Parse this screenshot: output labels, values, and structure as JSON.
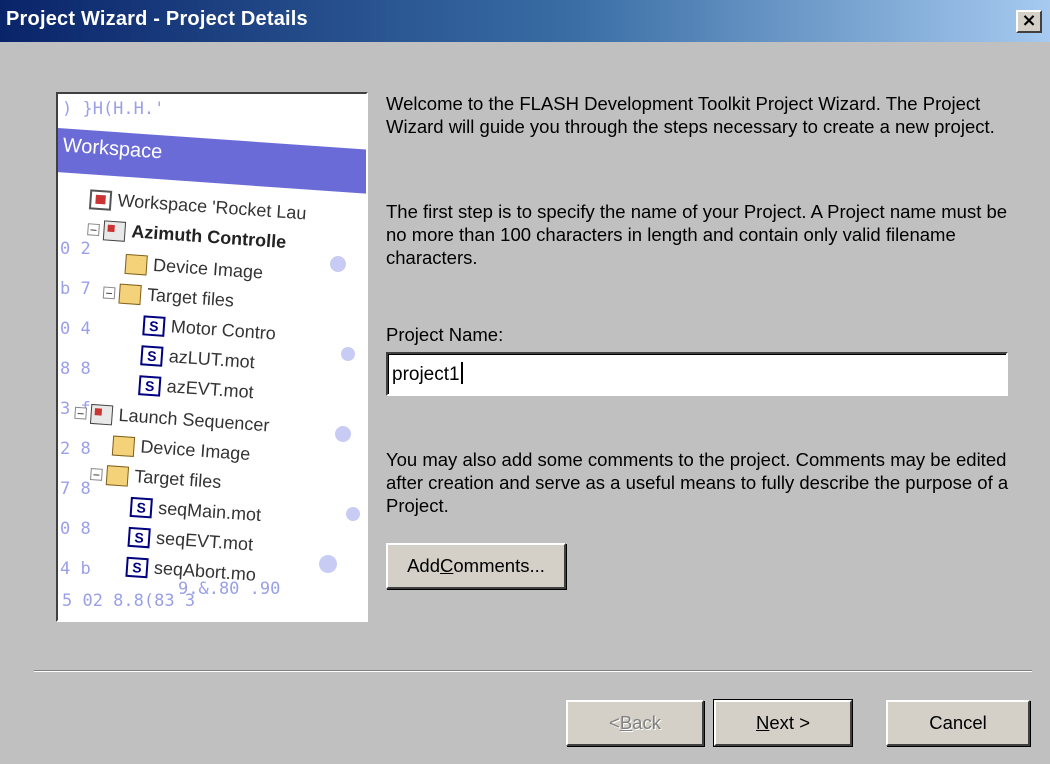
{
  "window": {
    "title": "Project Wizard - Project Details",
    "close_glyph": "×"
  },
  "illustration": {
    "workspace_header": "Workspace",
    "tree": [
      {
        "label": "Workspace 'Rocket Lau",
        "icon": "workspace-icon"
      },
      {
        "label": "Azimuth Controlle",
        "icon": "project-icon",
        "bold": true
      },
      {
        "label": "Device Image",
        "icon": "folder-icon"
      },
      {
        "label": "Target files",
        "icon": "folder-icon"
      },
      {
        "label": "Motor Contro",
        "icon": "s-file-icon"
      },
      {
        "label": "azLUT.mot",
        "icon": "s-file-icon"
      },
      {
        "label": "azEVT.mot",
        "icon": "s-file-icon"
      },
      {
        "label": "Launch Sequencer",
        "icon": "project-icon"
      },
      {
        "label": "Device Image",
        "icon": "folder-icon"
      },
      {
        "label": "Target files",
        "icon": "folder-icon"
      },
      {
        "label": "seqMain.mot",
        "icon": "s-file-icon"
      },
      {
        "label": "seqEVT.mot",
        "icon": "s-file-icon"
      },
      {
        "label": "seqAbort.mo",
        "icon": "s-file-icon"
      }
    ]
  },
  "content": {
    "intro": "Welcome to the FLASH Development Toolkit Project Wizard. The Project Wizard will guide you through the steps necessary to create a new project.",
    "first_step": "The first step is to specify the name of your Project. A Project name must be no more than 100 characters in length and contain only valid filename characters.",
    "project_name_label": "Project Name:",
    "project_name_value": "project1",
    "comments_text": "You may also add some comments to the project. Comments may be edited after creation and serve as a useful means to fully describe the purpose of a Project.",
    "add_comments_label_pre": "Add ",
    "add_comments_label_u": "C",
    "add_comments_label_post": "omments..."
  },
  "footer": {
    "back_pre": "< ",
    "back_u": "B",
    "back_post": "ack",
    "next_u": "N",
    "next_post": "ext >",
    "cancel": "Cancel"
  }
}
